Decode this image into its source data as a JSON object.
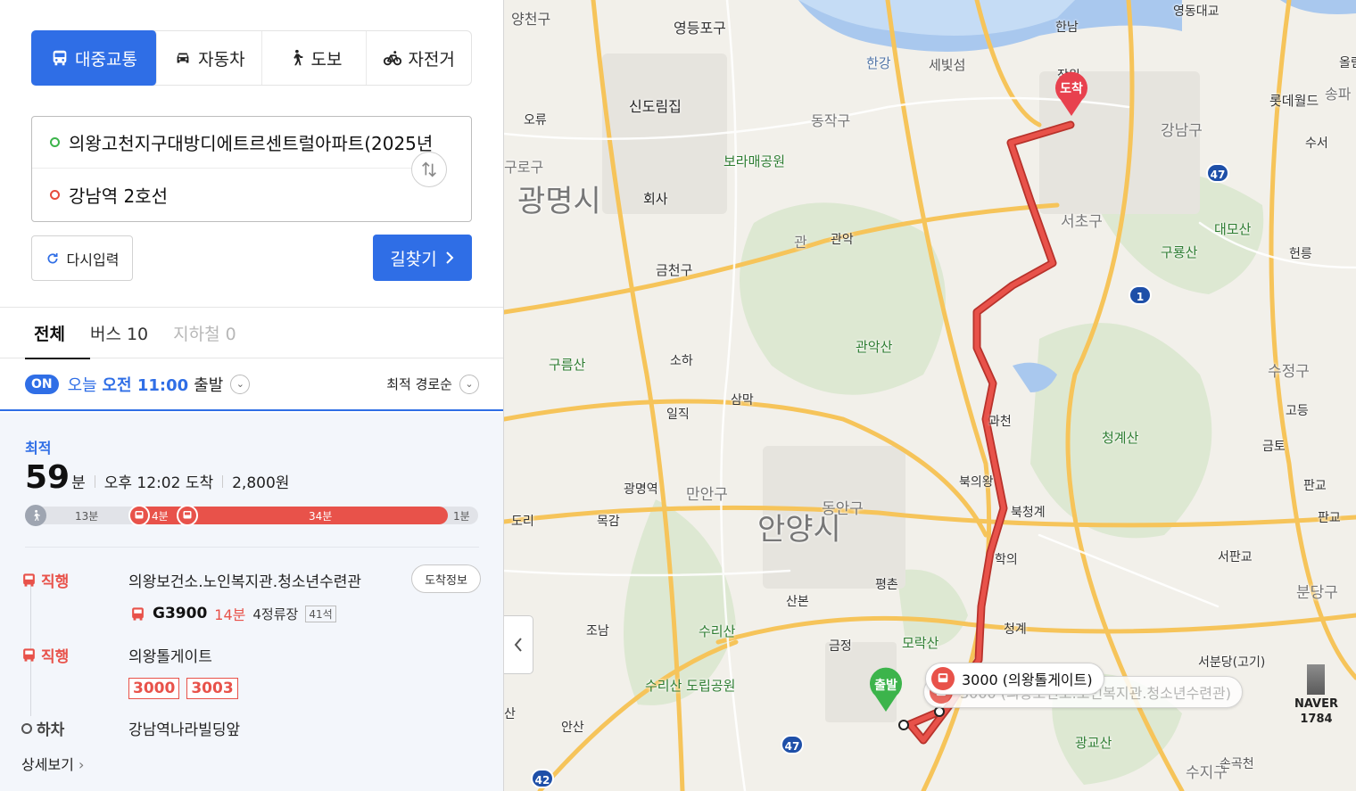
{
  "modes": [
    {
      "label": "대중교통",
      "icon": "bus-icon",
      "active": true
    },
    {
      "label": "자동차",
      "icon": "car-icon",
      "active": false
    },
    {
      "label": "도보",
      "icon": "walk-icon",
      "active": false
    },
    {
      "label": "자전거",
      "icon": "bike-icon",
      "active": false
    }
  ],
  "route": {
    "start": "의왕고천지구대방디에트르센트럴아파트(2025년",
    "end": "강남역 2호선"
  },
  "buttons": {
    "reset": "다시입력",
    "search": "길찾기"
  },
  "tabs": [
    {
      "label": "전체",
      "state": "active"
    },
    {
      "label": "버스 10",
      "state": "normal"
    },
    {
      "label": "지하철 0",
      "state": "disabled"
    }
  ],
  "depart": {
    "badge": "ON",
    "day": "오늘",
    "time": "오전 11:00",
    "suffix": "출발",
    "sort": "최적 경로순"
  },
  "result": {
    "label": "최적",
    "minutes": "59",
    "unit": "분",
    "arrival": "오후 12:02 도착",
    "fare": "2,800원",
    "bar": {
      "walk": "13분",
      "wait": "4분",
      "ride": "34분",
      "end": "1분"
    },
    "steps": [
      {
        "tag": "직행",
        "name": "의왕보건소.노인복지관.청소년수련관",
        "arrive_btn": "도착정보",
        "bus": "G3900",
        "minutes": "14분",
        "stops": "4정류장",
        "seats": "41석"
      },
      {
        "tag": "직행",
        "name": "의왕톨게이트",
        "chips": [
          "3000",
          "3003"
        ]
      },
      {
        "tag": "하차",
        "name": "강남역나라빌딩앞"
      }
    ],
    "more": "상세보기"
  },
  "map": {
    "labels": {
      "yangcheon": "양천구",
      "yeongdeungpo": "영등포구",
      "hannam": "한남",
      "yeongdong": "영동대교",
      "hangang": "한강",
      "saebit": "세빛섬",
      "jamwon": "잠원",
      "lotte": "롯데월드",
      "songpa": "송파",
      "olym": "올림",
      "sindorim": "신도림집",
      "ori": "오류",
      "dongjak": "동작구",
      "gangnam": "강남구",
      "suseo": "수서",
      "guro": "구로구",
      "borame": "보라매공원",
      "gwangmyeong": "광명시",
      "company": "회사",
      "seocho": "서초구",
      "daemo": "대모산",
      "guryong": "구룡산",
      "heonreung": "헌릉",
      "gwanak": "관악",
      "gwanak_gu": "관",
      "geumcheon": "금천구",
      "gwanaksan": "관악산",
      "gureumsan": "구름산",
      "soha": "소하",
      "sujeong": "수정구",
      "samak": "삼막",
      "ilik": "일직",
      "gwacheon": "과천",
      "cheonggyesan": "청계산",
      "godeung": "고등",
      "geumto": "금토",
      "gwangmyeong_st": "광명역",
      "manan": "만안구",
      "buguiwang": "북의왕",
      "pangyo": "판교",
      "pangyo2": "판교",
      "dori": "도리",
      "mokgam": "목감",
      "dongan": "동안구",
      "anyang": "안양시",
      "bukcheonggye": "북청계",
      "hakui": "학의",
      "seopangyo": "서판교",
      "bundang": "분당구",
      "sanbon": "산본",
      "pyeongchon": "평촌",
      "joam": "조남",
      "surisan": "수리산",
      "moraksan": "모락산",
      "cheonggye": "청계",
      "geumjeong": "금정",
      "seobundang": "서분당(고기)",
      "surisan_park": "수리산 도립공원",
      "ansan": "안산",
      "gwanggyo": "광교산",
      "suji": "수지구",
      "songgok": "손곡천",
      "route47a": "47",
      "route47b": "47",
      "route42": "42",
      "route1": "1",
      "san": "산"
    },
    "pin_start": "출발",
    "pin_end": "도착",
    "callout_1": "3000 (의왕톨게이트)",
    "callout_2": "3000 (의왕보건소.노인복지관.청소년수련관)",
    "naver": "NAVER",
    "naver_num": "1784"
  },
  "colors": {
    "accent": "#2f6ee6",
    "route": "#e8524a",
    "start_pin": "#3cb44b",
    "end_pin": "#e8414e"
  }
}
